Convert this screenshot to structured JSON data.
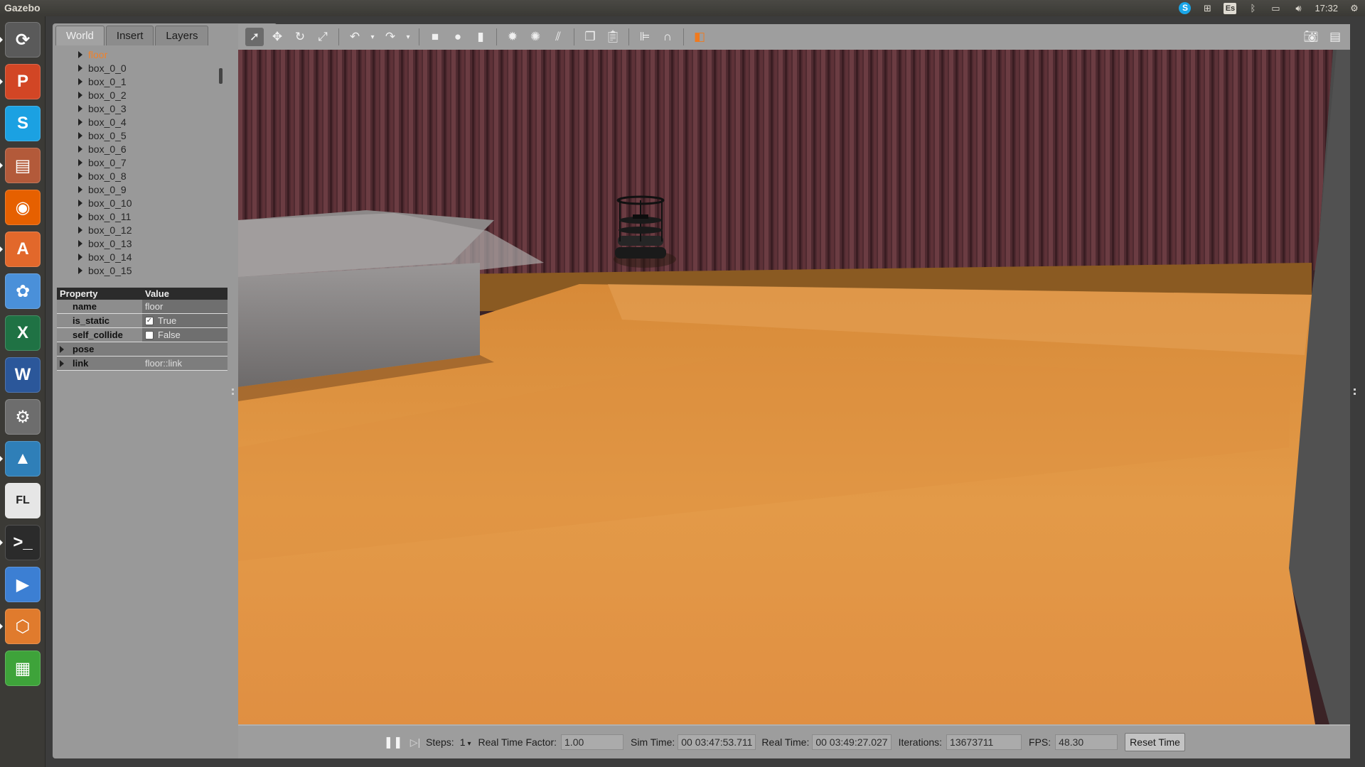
{
  "topbar": {
    "app_title": "Gazebo",
    "keyboard_layout": "Es",
    "clock": "17:32"
  },
  "launcher": {
    "items": [
      {
        "name": "dash-home",
        "glyph": "⟳",
        "color": "#5a5a5a"
      },
      {
        "name": "powerpoint",
        "glyph": "P",
        "color": "#d24625"
      },
      {
        "name": "skype",
        "glyph": "S",
        "color": "#1ba1e2"
      },
      {
        "name": "files",
        "glyph": "▤",
        "color": "#b35a3a"
      },
      {
        "name": "firefox",
        "glyph": "◉",
        "color": "#e66000"
      },
      {
        "name": "software-center",
        "glyph": "A",
        "color": "#e2682b"
      },
      {
        "name": "picasa",
        "glyph": "✿",
        "color": "#4a90d9"
      },
      {
        "name": "excel",
        "glyph": "X",
        "color": "#1f7244"
      },
      {
        "name": "word",
        "glyph": "W",
        "color": "#2b579a"
      },
      {
        "name": "system-settings",
        "glyph": "⚙",
        "color": "#6d6d6d"
      },
      {
        "name": "matlab",
        "glyph": "▲",
        "color": "#2f7fb8"
      },
      {
        "name": "fledps",
        "glyph": "FL",
        "color": "#e6e6e6"
      },
      {
        "name": "terminal",
        "glyph": ">_",
        "color": "#2b2b2b"
      },
      {
        "name": "media-player",
        "glyph": "▶",
        "color": "#3c7fd3"
      },
      {
        "name": "gazebo",
        "glyph": "⬡",
        "color": "#e07b2d"
      },
      {
        "name": "calc",
        "glyph": "▦",
        "color": "#3ea33a"
      }
    ]
  },
  "left_panel": {
    "tabs": [
      {
        "label": "World",
        "active": true
      },
      {
        "label": "Insert",
        "active": false
      },
      {
        "label": "Layers",
        "active": false
      }
    ],
    "tree": [
      {
        "label": "floor",
        "selected": true
      },
      {
        "label": "box_0_0"
      },
      {
        "label": "box_0_1"
      },
      {
        "label": "box_0_2"
      },
      {
        "label": "box_0_3"
      },
      {
        "label": "box_0_4"
      },
      {
        "label": "box_0_5"
      },
      {
        "label": "box_0_6"
      },
      {
        "label": "box_0_7"
      },
      {
        "label": "box_0_8"
      },
      {
        "label": "box_0_9"
      },
      {
        "label": "box_0_10"
      },
      {
        "label": "box_0_11"
      },
      {
        "label": "box_0_12"
      },
      {
        "label": "box_0_13"
      },
      {
        "label": "box_0_14"
      },
      {
        "label": "box_0_15"
      }
    ],
    "properties": {
      "header_property": "Property",
      "header_value": "Value",
      "name_key": "name",
      "name_value": "floor",
      "is_static_key": "is_static",
      "is_static_value": "True",
      "self_collide_key": "self_collide",
      "self_collide_value": "False",
      "pose_key": "pose",
      "link_key": "link",
      "link_value": "floor::link"
    }
  },
  "bottom_bar": {
    "steps_label": "Steps:",
    "steps_value": "1",
    "rtf_label": "Real Time Factor:",
    "rtf_value": "1.00",
    "sim_time_label": "Sim Time:",
    "sim_time_value": "00 03:47:53.711",
    "real_time_label": "Real Time:",
    "real_time_value": "00 03:49:27.027",
    "iterations_label": "Iterations:",
    "iterations_value": "13673711",
    "fps_label": "FPS:",
    "fps_value": "48.30",
    "reset_label": "Reset Time"
  },
  "colors": {
    "floor": "#e0953e",
    "wall": "#5a2f35",
    "selected_text": "#f0812a"
  }
}
